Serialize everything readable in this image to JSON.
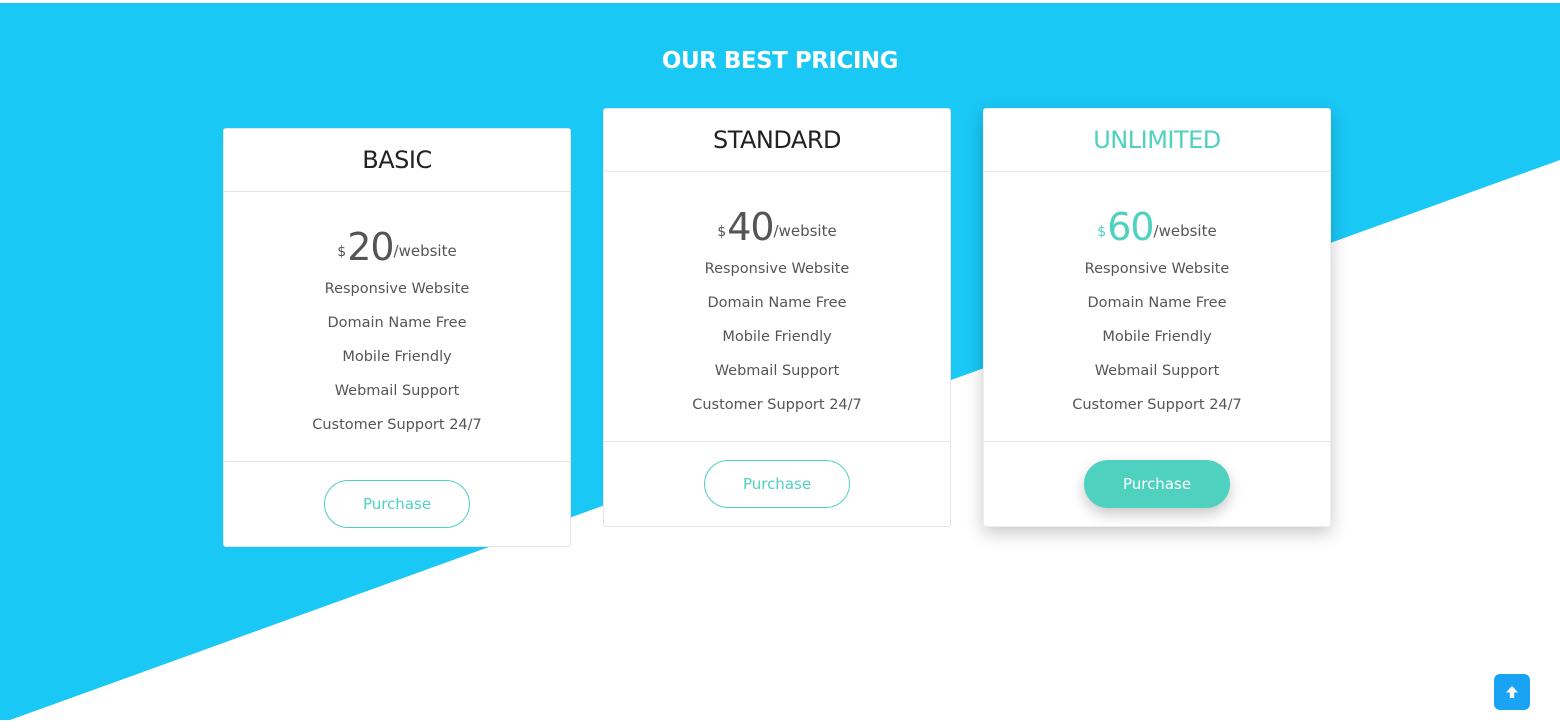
{
  "page": {
    "title": "OUR BEST PRICING"
  },
  "colors": {
    "brand_blue": "#1ac8f6",
    "accent_teal": "#4fd1c0",
    "scroll_top_blue": "#1aa3f5"
  },
  "plans": [
    {
      "name": "BASIC",
      "currency": "$",
      "amount": "20",
      "unit": "/website",
      "features": [
        "Responsive Website",
        "Domain Name Free",
        "Mobile Friendly",
        "Webmail Support",
        "Customer Support 24/7"
      ],
      "button_label": "Purchase"
    },
    {
      "name": "STANDARD",
      "currency": "$",
      "amount": "40",
      "unit": "/website",
      "features": [
        "Responsive Website",
        "Domain Name Free",
        "Mobile Friendly",
        "Webmail Support",
        "Customer Support 24/7"
      ],
      "button_label": "Purchase"
    },
    {
      "name": "UNLIMITED",
      "currency": "$",
      "amount": "60",
      "unit": "/website",
      "features": [
        "Responsive Website",
        "Domain Name Free",
        "Mobile Friendly",
        "Webmail Support",
        "Customer Support 24/7"
      ],
      "button_label": "Purchase"
    }
  ],
  "scroll_top": {
    "icon": "arrow-up-icon"
  }
}
